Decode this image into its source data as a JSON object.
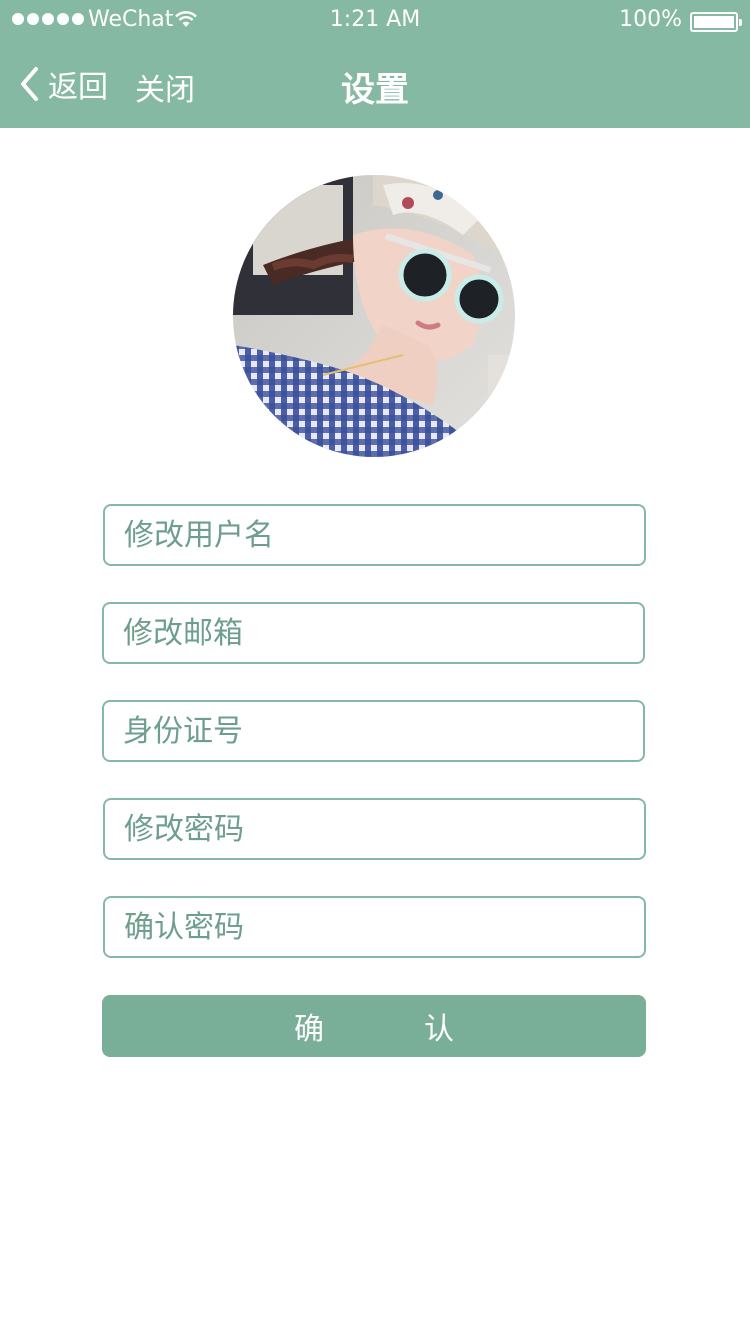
{
  "status_bar": {
    "carrier": "WeChat",
    "time": "1:21 AM",
    "battery": "100%"
  },
  "nav": {
    "back_label": "返回",
    "close_label": "关闭",
    "title": "设置"
  },
  "form": {
    "username_placeholder": "修改用户名",
    "email_placeholder": "修改邮箱",
    "id_placeholder": "身份证号",
    "password_placeholder": "修改密码",
    "confirm_password_placeholder": "确认密码",
    "submit_label": "确认"
  },
  "colors": {
    "accent": "#86b9a4",
    "button": "#79ae99"
  },
  "icons": [
    "signal-icon",
    "wifi-icon",
    "battery-icon",
    "chevron-left-icon"
  ]
}
